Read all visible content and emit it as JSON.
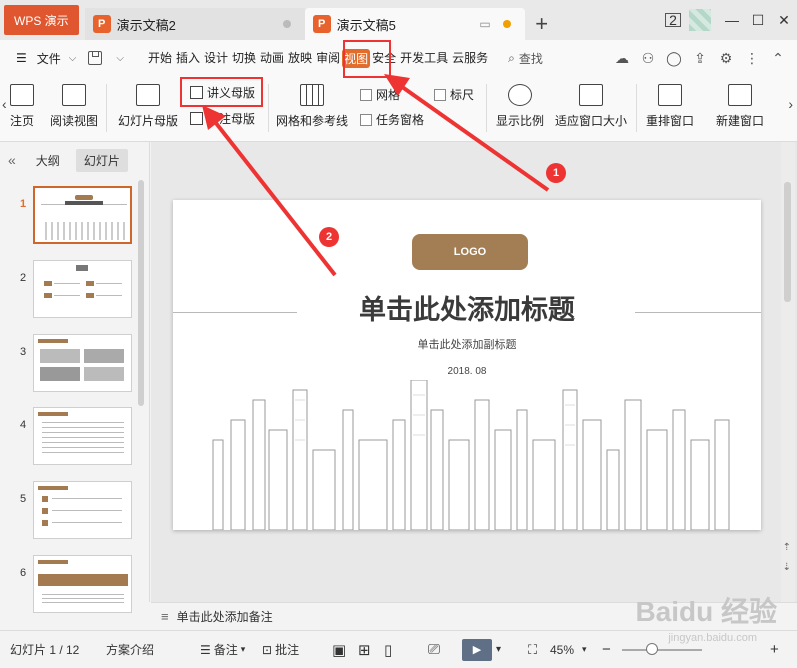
{
  "titlebar": {
    "app_label": "WPS 演示",
    "tabs": [
      {
        "label": "演示文稿2"
      },
      {
        "label": "演示文稿5"
      }
    ],
    "num_badge": "2"
  },
  "menubar": {
    "file_label": "文件",
    "tabs": [
      "开始",
      "插入",
      "设计",
      "切换",
      "动画",
      "放映",
      "审阅",
      "视图",
      "安全",
      "开发工具",
      "云服务"
    ],
    "search_label": "查找"
  },
  "ribbon": {
    "notes_page": "注页",
    "reading_view": "阅读视图",
    "slide_master": "幻灯片母版",
    "handout_master": "讲义母版",
    "notes_master": "备注母版",
    "grid_guides": "网格和参考线",
    "grid": "网格",
    "ruler": "标尺",
    "task_pane": "任务窗格",
    "zoom": "显示比例",
    "fit_window": "适应窗口大小",
    "arrange_windows": "重排窗口",
    "new_window": "新建窗口"
  },
  "sidebar": {
    "outline_tab": "大纲",
    "slides_tab": "幻灯片",
    "slides": [
      {
        "num": "1"
      },
      {
        "num": "2"
      },
      {
        "num": "3"
      },
      {
        "num": "4"
      },
      {
        "num": "5"
      },
      {
        "num": "6"
      }
    ]
  },
  "slide": {
    "logo": "LOGO",
    "title": "单击此处添加标题",
    "subtitle": "单击此处添加副标题",
    "date": "2018. 08"
  },
  "notes": {
    "placeholder": "单击此处添加备注"
  },
  "status": {
    "slide_counter": "幻灯片 1 / 12",
    "theme": "方案介绍",
    "notes_btn": "备注",
    "comments_btn": "批注",
    "zoom": "45%"
  },
  "annotations": {
    "badge1": "1",
    "badge2": "2"
  },
  "watermark": {
    "brand": "Baidu 经验",
    "url": "jingyan.baidu.com"
  },
  "colors": {
    "accent": "#e26c2b",
    "logo_brown": "#a37d53",
    "annotation_red": "#e33333"
  }
}
